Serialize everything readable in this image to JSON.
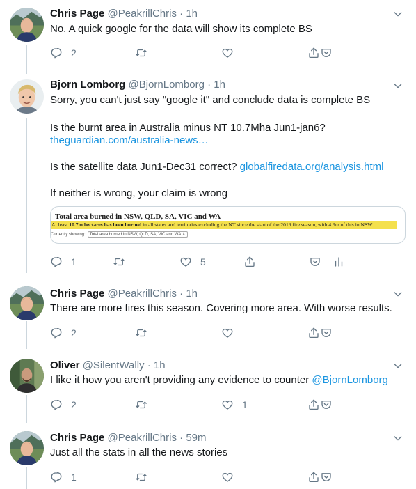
{
  "tweets": [
    {
      "name": "Chris Page",
      "handle": "@PeakrillChris",
      "time": "1h",
      "lines": [
        "No. A quick google for the data will show its complete BS"
      ],
      "replies": "2",
      "likes": "",
      "retweets": ""
    },
    {
      "name": "Bjorn Lomborg",
      "handle": "@BjornLomborg",
      "time": "1h",
      "line1": "Sorry, you can't just say \"google it\" and conclude data is complete BS",
      "line2": "Is the burnt area in Australia minus NT 10.7Mha Jun1-jan6?",
      "line3_link": "theguardian.com/australia-news…",
      "line4_text": "Is the satellite data Jun1-Dec31 correct?",
      "line4_link": "globalfiredata.org/analysis.html",
      "line5": "If neither is wrong, your claim is wrong",
      "replies": "1",
      "likes": "5"
    },
    {
      "name": "Chris Page",
      "handle": "@PeakrillChris",
      "time": "1h",
      "line1": "There are more fires this season. Covering more area. With worse results.",
      "replies": "2"
    },
    {
      "name": "Oliver",
      "handle": "@SilentWally",
      "time": "1h",
      "line1_text": "I like it how you aren't providing any evidence to counter",
      "line1_mention": "@BjornLomborg",
      "replies": "2",
      "likes": "1"
    },
    {
      "name": "Chris Page",
      "handle": "@PeakrillChris",
      "time": "59m",
      "line1": "Just all the stats in all the news stories",
      "replies": "1"
    }
  ],
  "card": {
    "title": "Total area burned in NSW, QLD, SA, VIC and WA",
    "highlight_prefix": "At least ",
    "highlight_bold": "10.7m hectares has been burned",
    "highlight_rest": " in all states and territories excluding the NT since the start of the 2019 fire season, with 4.9m of this in NSW",
    "showing_label": "Currently showing:",
    "showing_value": "Total area burned in NSW, QLD, SA, VIC and WA ⇕"
  },
  "separator": "·",
  "colors": {
    "link": "#1b95e0",
    "muted": "#657786",
    "divider": "#e6ecf0",
    "highlight": "#f4e04d"
  },
  "icons": [
    "reply-icon",
    "retweet-icon",
    "like-icon",
    "share-icon",
    "save-icon",
    "analytics-icon",
    "chevron-down-icon"
  ]
}
